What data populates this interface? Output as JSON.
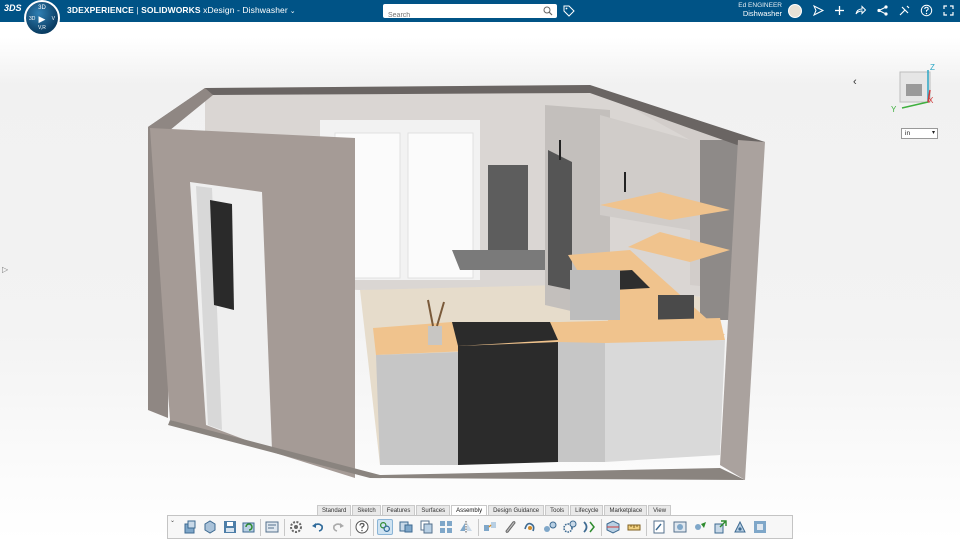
{
  "header": {
    "logo": "3DS",
    "brand": "3DEXPERIENCE",
    "separator": " | ",
    "product": "SOLIDWORKS",
    "app": " xDesign - ",
    "document": "Dishwasher",
    "caret": "⌄",
    "search_placeholder": "Search",
    "user_name": "Ed ENGINEER",
    "user_context": "Dishwasher"
  },
  "compass": {
    "top": "3D",
    "left": "3D",
    "right": "V",
    "center": "▶",
    "bottom": "V,R"
  },
  "viewport": {
    "collapse_glyph": "‹",
    "side_handle_glyph": "▷",
    "triad_labels": {
      "x": "X",
      "y": "Y",
      "z": "Z"
    },
    "units": {
      "value": "in",
      "arrow": "▾"
    }
  },
  "toolbar": {
    "tabs": [
      "Standard",
      "Sketch",
      "Features",
      "Surfaces",
      "Assembly",
      "Design Guidance",
      "Tools",
      "Lifecycle",
      "Marketplace",
      "View"
    ],
    "active_tab": "Assembly",
    "collapse_glyph": "⌄"
  },
  "colors": {
    "topbar": "#005386",
    "wall_outer": "#a59b96",
    "wall_inner": "#dcd8d5",
    "countertop": "#f0c38d",
    "cabinet": "#c8c8c8",
    "appliance": "#2b2b2b"
  }
}
